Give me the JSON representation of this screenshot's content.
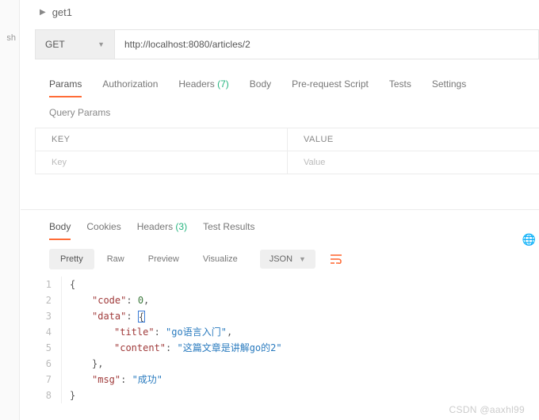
{
  "left_tab_fragment": "sh",
  "request": {
    "expand_icon": "▶",
    "name": "get1",
    "method": "GET",
    "url": "http://localhost:8080/articles/2"
  },
  "req_tabs": {
    "params": "Params",
    "auth": "Authorization",
    "headers": "Headers",
    "headers_count": "(7)",
    "body": "Body",
    "prereq": "Pre-request Script",
    "tests": "Tests",
    "settings": "Settings"
  },
  "query_params": {
    "title": "Query Params",
    "key_header": "KEY",
    "value_header": "VALUE",
    "key_placeholder": "Key",
    "value_placeholder": "Value"
  },
  "res_tabs": {
    "body": "Body",
    "cookies": "Cookies",
    "headers": "Headers",
    "headers_count": "(3)",
    "test_results": "Test Results"
  },
  "res_toolbar": {
    "pretty": "Pretty",
    "raw": "Raw",
    "preview": "Preview",
    "visualize": "Visualize",
    "format": "JSON"
  },
  "response_json": {
    "l1": "{",
    "l2_k": "\"code\"",
    "l2_v": "0",
    "l3_k": "\"data\"",
    "l3_v": "{",
    "l4_k": "\"title\"",
    "l4_v": "\"go语言入门\"",
    "l5_k": "\"content\"",
    "l5_v": "\"这篇文章是讲解go的2\"",
    "l6": "},",
    "l7_k": "\"msg\"",
    "l7_v": "\"成功\"",
    "l8": "}"
  },
  "watermark": "CSDN @aaxhl99"
}
